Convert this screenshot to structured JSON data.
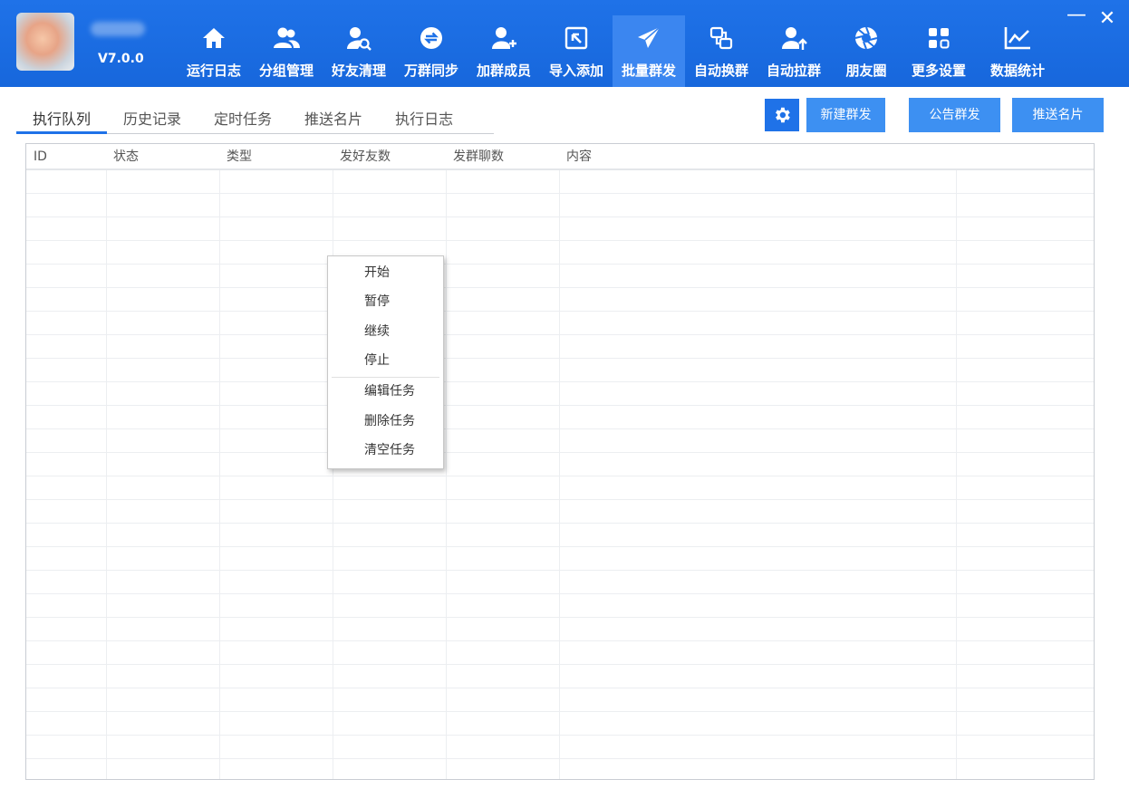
{
  "header": {
    "version": "V7.0.0",
    "nav": [
      {
        "label": "运行日志",
        "icon": "home-icon"
      },
      {
        "label": "分组管理",
        "icon": "users-icon"
      },
      {
        "label": "好友清理",
        "icon": "user-search-icon"
      },
      {
        "label": "万群同步",
        "icon": "sync-icon"
      },
      {
        "label": "加群成员",
        "icon": "user-add-icon"
      },
      {
        "label": "导入添加",
        "icon": "import-icon"
      },
      {
        "label": "批量群发",
        "icon": "send-icon",
        "active": true
      },
      {
        "label": "自动换群",
        "icon": "switch-icon"
      },
      {
        "label": "自动拉群",
        "icon": "user-up-icon"
      },
      {
        "label": "朋友圈",
        "icon": "aperture-icon"
      },
      {
        "label": "更多设置",
        "icon": "grid-icon"
      },
      {
        "label": "数据统计",
        "icon": "line-chart-icon"
      }
    ],
    "minimize": "—",
    "close": "✕"
  },
  "tabs": [
    "执行队列",
    "历史记录",
    "定时任务",
    "推送名片",
    "执行日志"
  ],
  "actions": {
    "settings_icon": "gear-icon",
    "new_broadcast": "新建群发",
    "notice_broadcast": "公告群发",
    "push_card": "推送名片"
  },
  "table": {
    "columns": [
      "ID",
      "状态",
      "类型",
      "发好友数",
      "发群聊数",
      "内容"
    ]
  },
  "context_menu": {
    "items": [
      "开始",
      "暂停",
      "继续",
      "停止",
      "编辑任务",
      "删除任务",
      "清空任务"
    ]
  },
  "colors": {
    "header_bg": "#1f72e8",
    "active_nav": "#3b86f0",
    "button_bg": "#3d90f2"
  }
}
